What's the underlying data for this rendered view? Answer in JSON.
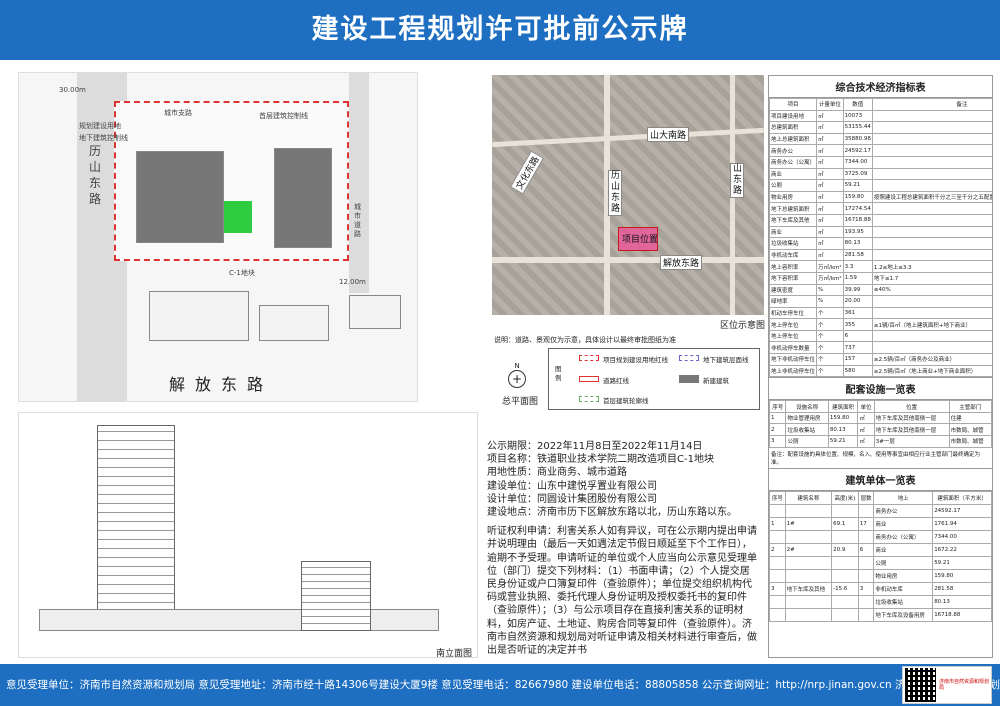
{
  "header": {
    "title": "建设工程规划许可批前公示牌"
  },
  "site_plan": {
    "roads": {
      "left": "历山东路",
      "bottom": "解放东路",
      "right": "城市道路"
    },
    "top_street_label": "城市支路",
    "legend_title": "图例",
    "caption": "总平面图",
    "block_label": "C-1地块",
    "dims": [
      "30.00m",
      "12.00m"
    ],
    "labels": [
      "规划建设用地",
      "首层建筑控制线",
      "地下建筑控制线"
    ]
  },
  "aerial": {
    "labels": [
      "山大南路",
      "历山东路",
      "山东路",
      "项目位置",
      "解放东路",
      "文化东路"
    ],
    "caption": "区位示意图"
  },
  "note": "说明：道路、景观仅为示意，具体设计以最终审批图纸为准",
  "legend": {
    "label": "图例",
    "items": [
      "项目规划建设用地红线",
      "地下建筑层面线",
      "道路红线",
      "新建建筑",
      "首层建筑轮廓线"
    ]
  },
  "elevation": {
    "caption": "南立面图"
  },
  "info": {
    "period": "公示期限：2022年11月8日至2022年11月14日",
    "project": "项目名称：铁道职业技术学院二期改造项目C-1地块",
    "land_use": "用地性质：商业商务、城市道路",
    "builder": "建设单位：山东中建悦孚置业有限公司",
    "designer": "设计单位：同圆设计集团股份有限公司",
    "location": "建设地点：济南市历下区解放东路以北，历山东路以东。",
    "hearing": "听证权利申请：利害关系人如有异议，可在公示期内提出申请并说明理由（最后一天如遇法定节假日顺延至下个工作日），逾期不予受理。申请听证的单位或个人应当向公示意见受理单位（部门）提交下列材料：（1）书面申请；（2）个人提交居民身份证或户口簿复印件（查验原件）；单位提交组织机构代码或营业执照、委托代理人身份证明及授权委托书的复印件（查验原件）；（3）与公示项目存在直接利害关系的证明材料，如房产证、土地证、购房合同等复印件（查验原件）。济南市自然资源和规划局对听证申请及相关材料进行审查后，做出是否听证的决定并书"
  },
  "panel": {
    "t1_title": "综合技术经济指标表",
    "t1_head": [
      "项目",
      "计量单位",
      "数值",
      "备注"
    ],
    "t1_rows": [
      [
        "项目建设用地",
        "㎡",
        "10073",
        ""
      ],
      [
        "总建筑面积",
        "㎡",
        "53155.44",
        ""
      ],
      [
        "地上总建筑面积",
        "㎡",
        "35880.98",
        ""
      ],
      [
        "商务办公",
        "㎡",
        "24592.17",
        ""
      ],
      [
        "商务办公（公寓）",
        "㎡",
        "7344.00",
        ""
      ],
      [
        "商业",
        "㎡",
        "3725.09",
        ""
      ],
      [
        "公厕",
        "㎡",
        "59.21",
        ""
      ],
      [
        "物业用房",
        "㎡",
        "159.80",
        "按照建设工程总建筑面积千分之三至千分之五配置，最少不低于一百平米"
      ],
      [
        "地下总建筑面积",
        "㎡",
        "17274.54",
        ""
      ],
      [
        "地下车库及其他",
        "㎡",
        "16718.88",
        ""
      ],
      [
        "商业",
        "㎡",
        "193.95",
        ""
      ],
      [
        "垃圾收集站",
        "㎡",
        "80.13",
        ""
      ],
      [
        "非机动车库",
        "㎡",
        "281.58",
        ""
      ],
      [
        "地上容积率",
        "万㎡/km²",
        "3.3",
        "1.2≤地上≤3.3"
      ],
      [
        "地下容积率",
        "万㎡/km²",
        "1.59",
        "地下≤1.7"
      ],
      [
        "建筑密度",
        "%",
        "39.99",
        "≤40%"
      ],
      [
        "绿地率",
        "%",
        "20.00",
        ""
      ],
      [
        "机动车停车位",
        "个",
        "361",
        ""
      ],
      [
        "地上停车位",
        "个",
        "355",
        "≥1辆/百㎡（地上建筑面积+地下商业）"
      ],
      [
        "地上停车位",
        "个",
        "6",
        ""
      ],
      [
        "非机动停车数量",
        "个",
        "737",
        ""
      ],
      [
        "地下非机动停车位",
        "个",
        "157",
        "≥2.5辆/百㎡（商务办公及商业）"
      ],
      [
        "地上非机动停车位",
        "个",
        "580",
        "≥2.5辆/百㎡（地上商业+地下商业面积）"
      ]
    ],
    "t2_title": "配套设施一览表",
    "t2_head": [
      "序号",
      "设施名称",
      "建筑面积",
      "单位",
      "位置",
      "主管部门"
    ],
    "t2_rows": [
      [
        "1",
        "物业管理用房",
        "159.80",
        "㎡",
        "地下车库及其他南侧一层",
        "住建"
      ],
      [
        "2",
        "垃圾收集站",
        "80.13",
        "㎡",
        "地下车库及其他南侧一层",
        "市数局、城管"
      ],
      [
        "3",
        "公厕",
        "59.21",
        "㎡",
        "3#一层",
        "市数局、城管"
      ]
    ],
    "t2_note": "备注：配套设施的具体位置、规模、名入、使用等事宜由相应行业主管部门最终确定为准。",
    "t3_title": "建筑单体一览表",
    "t3_head": [
      "序号",
      "建筑名称",
      "高度(米)",
      "层数",
      "地上",
      "建筑面积（平方米）"
    ],
    "t3_rows": [
      [
        "",
        "",
        "",
        "",
        "商务办公",
        "24592.17"
      ],
      [
        "1",
        "1#",
        "69.1",
        "17",
        "商业",
        "1761.94"
      ],
      [
        "",
        "",
        "",
        "",
        "商务办公（公寓）",
        "7344.00"
      ],
      [
        "2",
        "2#",
        "20.9",
        "6",
        "商业",
        "1672.22"
      ],
      [
        "",
        "",
        "",
        "",
        "公厕",
        "59.21"
      ],
      [
        "",
        "",
        "",
        "",
        "物业用房",
        "159.80"
      ],
      [
        "3",
        "地下车库及其他",
        "-15.6",
        "3",
        "非机动车库",
        "281.58"
      ],
      [
        "",
        "",
        "",
        "",
        "垃圾收集站",
        "80.13"
      ],
      [
        "",
        "",
        "",
        "",
        "地下车库及设备用房",
        "16718.88"
      ]
    ]
  },
  "footer": {
    "text": "意见受理单位：济南市自然资源和规划局   意见受理地址：济南市经十路14306号建设大厦9楼  意见受理电话：82667980   建设单位电话：88805858   公示查询网址：http://nrp.jinan.gov.cn   济南市自然资源和规划局监制",
    "qr_text": "济南市自然资源和规划局"
  }
}
